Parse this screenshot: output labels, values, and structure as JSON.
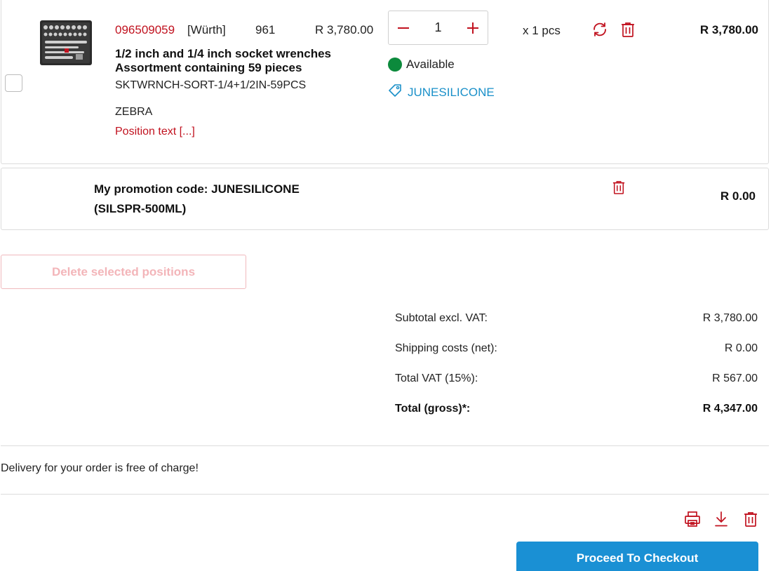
{
  "colors": {
    "brand_red": "#c1121f",
    "link_blue": "#1a90c9",
    "available_green": "#0c8a3c",
    "checkout_blue": "#1a90d4",
    "border": "#dcdcdc"
  },
  "item": {
    "article_number": "096509059",
    "brand": "[Würth]",
    "code": "961",
    "unit_price": "R 3,780.00",
    "title": "1/2 inch and 1/4 inch socket wrenches Assortment containing 59 pieces",
    "sku": "SKTWRNCH-SORT-1/4+1/2IN-59PCS",
    "customer_reference": "ZEBRA",
    "position_text": "Position text [...]",
    "quantity": "1",
    "unit_label": "x 1 pcs",
    "availability": "Available",
    "promotion_tag": "JUNESILICONE",
    "line_total": "R 3,780.00",
    "icons": [
      "minus-icon",
      "plus-icon",
      "refresh-icon",
      "trash-icon",
      "tag-icon",
      "product-image"
    ]
  },
  "promotion": {
    "label": "My promotion code: JUNESILICONE (SILSPR-500ML)",
    "total": "R 0.00",
    "icons": [
      "trash-icon"
    ]
  },
  "actions": {
    "delete_selected": "Delete selected positions",
    "checkout": "Proceed To Checkout",
    "icons": [
      "print-icon",
      "download-icon",
      "trash-icon"
    ]
  },
  "summary": [
    {
      "label": "Subtotal excl. VAT:",
      "value": "R 3,780.00"
    },
    {
      "label": "Shipping costs (net):",
      "value": "R 0.00"
    },
    {
      "label": "Total VAT (15%):",
      "value": "R 567.00"
    },
    {
      "label": "Total (gross)*:",
      "value": "R 4,347.00"
    }
  ],
  "delivery_note": "Delivery for your order is free of charge!"
}
